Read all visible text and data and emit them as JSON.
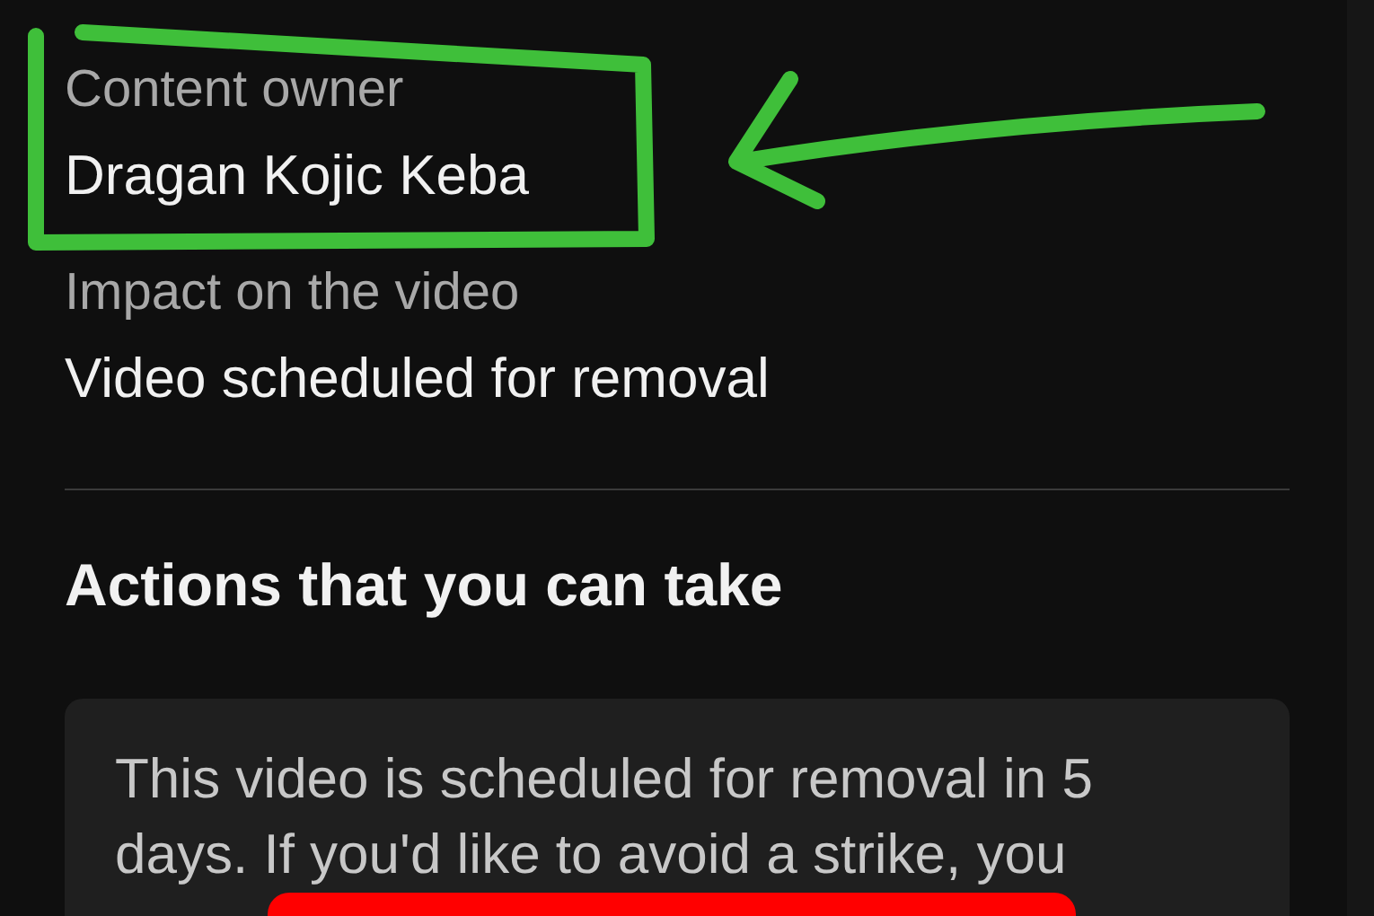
{
  "details": [
    {
      "label": "Content owner",
      "value": "Dragan Kojic Keba",
      "highlighted": true
    },
    {
      "label": "Impact on the video",
      "value": "Video scheduled for removal",
      "highlighted": false
    }
  ],
  "actions": {
    "heading": "Actions that you can take",
    "message": "This video is scheduled for removal in 5 days. If you'd like to avoid a strike, you"
  },
  "redacted": true
}
